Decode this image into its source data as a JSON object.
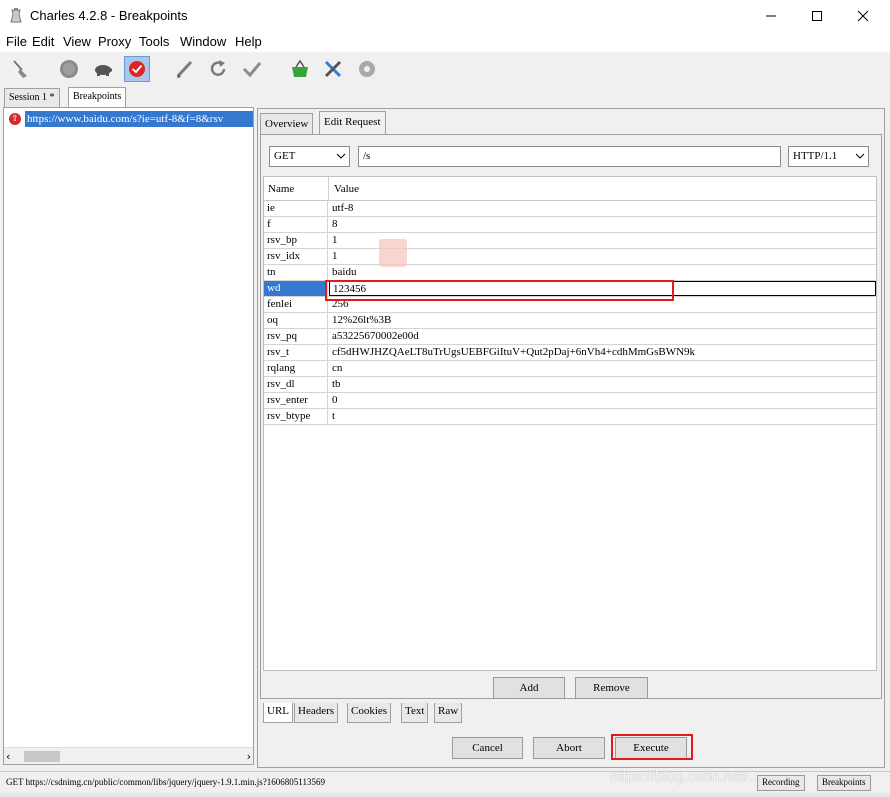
{
  "window": {
    "title": "Charles 4.2.8 - Breakpoints"
  },
  "menu": [
    "File",
    "Edit",
    "View",
    "Proxy",
    "Tools",
    "Window",
    "Help"
  ],
  "session_tabs": [
    {
      "label": "Session 1 *",
      "active": false
    },
    {
      "label": "Breakpoints",
      "active": true
    }
  ],
  "left_panel": {
    "item_url": "https://www.baidu.com/s?ie=utf-8&f=8&rsv"
  },
  "request_tabs": [
    {
      "label": "Overview",
      "active": false
    },
    {
      "label": "Edit Request",
      "active": true
    }
  ],
  "request": {
    "method": "GET",
    "path": "/s",
    "protocol": "HTTP/1.1"
  },
  "params": {
    "header_name": "Name",
    "header_value": "Value",
    "rows": [
      {
        "name": "ie",
        "value": "utf-8"
      },
      {
        "name": "f",
        "value": "8"
      },
      {
        "name": "rsv_bp",
        "value": "1"
      },
      {
        "name": "rsv_idx",
        "value": "1"
      },
      {
        "name": "tn",
        "value": "baidu"
      },
      {
        "name": "wd",
        "value": "123456",
        "selected": true
      },
      {
        "name": "fenlei",
        "value": "256"
      },
      {
        "name": "oq",
        "value": "12%26lt%3B"
      },
      {
        "name": "rsv_pq",
        "value": "a53225670002e00d"
      },
      {
        "name": "rsv_t",
        "value": "cf5dHWJHZQAeLT8uTrUgsUEBFGiItuV+Qut2pDaj+6nVh4+cdhMmGsBWN9k"
      },
      {
        "name": "rqlang",
        "value": "cn"
      },
      {
        "name": "rsv_dl",
        "value": "tb"
      },
      {
        "name": "rsv_enter",
        "value": "0"
      },
      {
        "name": "rsv_btype",
        "value": "t"
      }
    ]
  },
  "buttons": {
    "add": "Add",
    "remove": "Remove",
    "cancel": "Cancel",
    "abort": "Abort",
    "execute": "Execute"
  },
  "bottom_tabs": [
    {
      "label": "URL",
      "active": true
    },
    {
      "label": "Headers",
      "active": false
    },
    {
      "label": "Cookies",
      "active": false
    },
    {
      "label": "Text",
      "active": false
    },
    {
      "label": "Raw",
      "active": false
    }
  ],
  "status": {
    "text": "GET https://csdnimg.cn/public/common/libs/jquery/jquery-1.9.1.min.js?1606805113569",
    "recording": "Recording",
    "breakpoints": "Breakpoints"
  },
  "watermark": "https://blog.csdn.net/..."
}
